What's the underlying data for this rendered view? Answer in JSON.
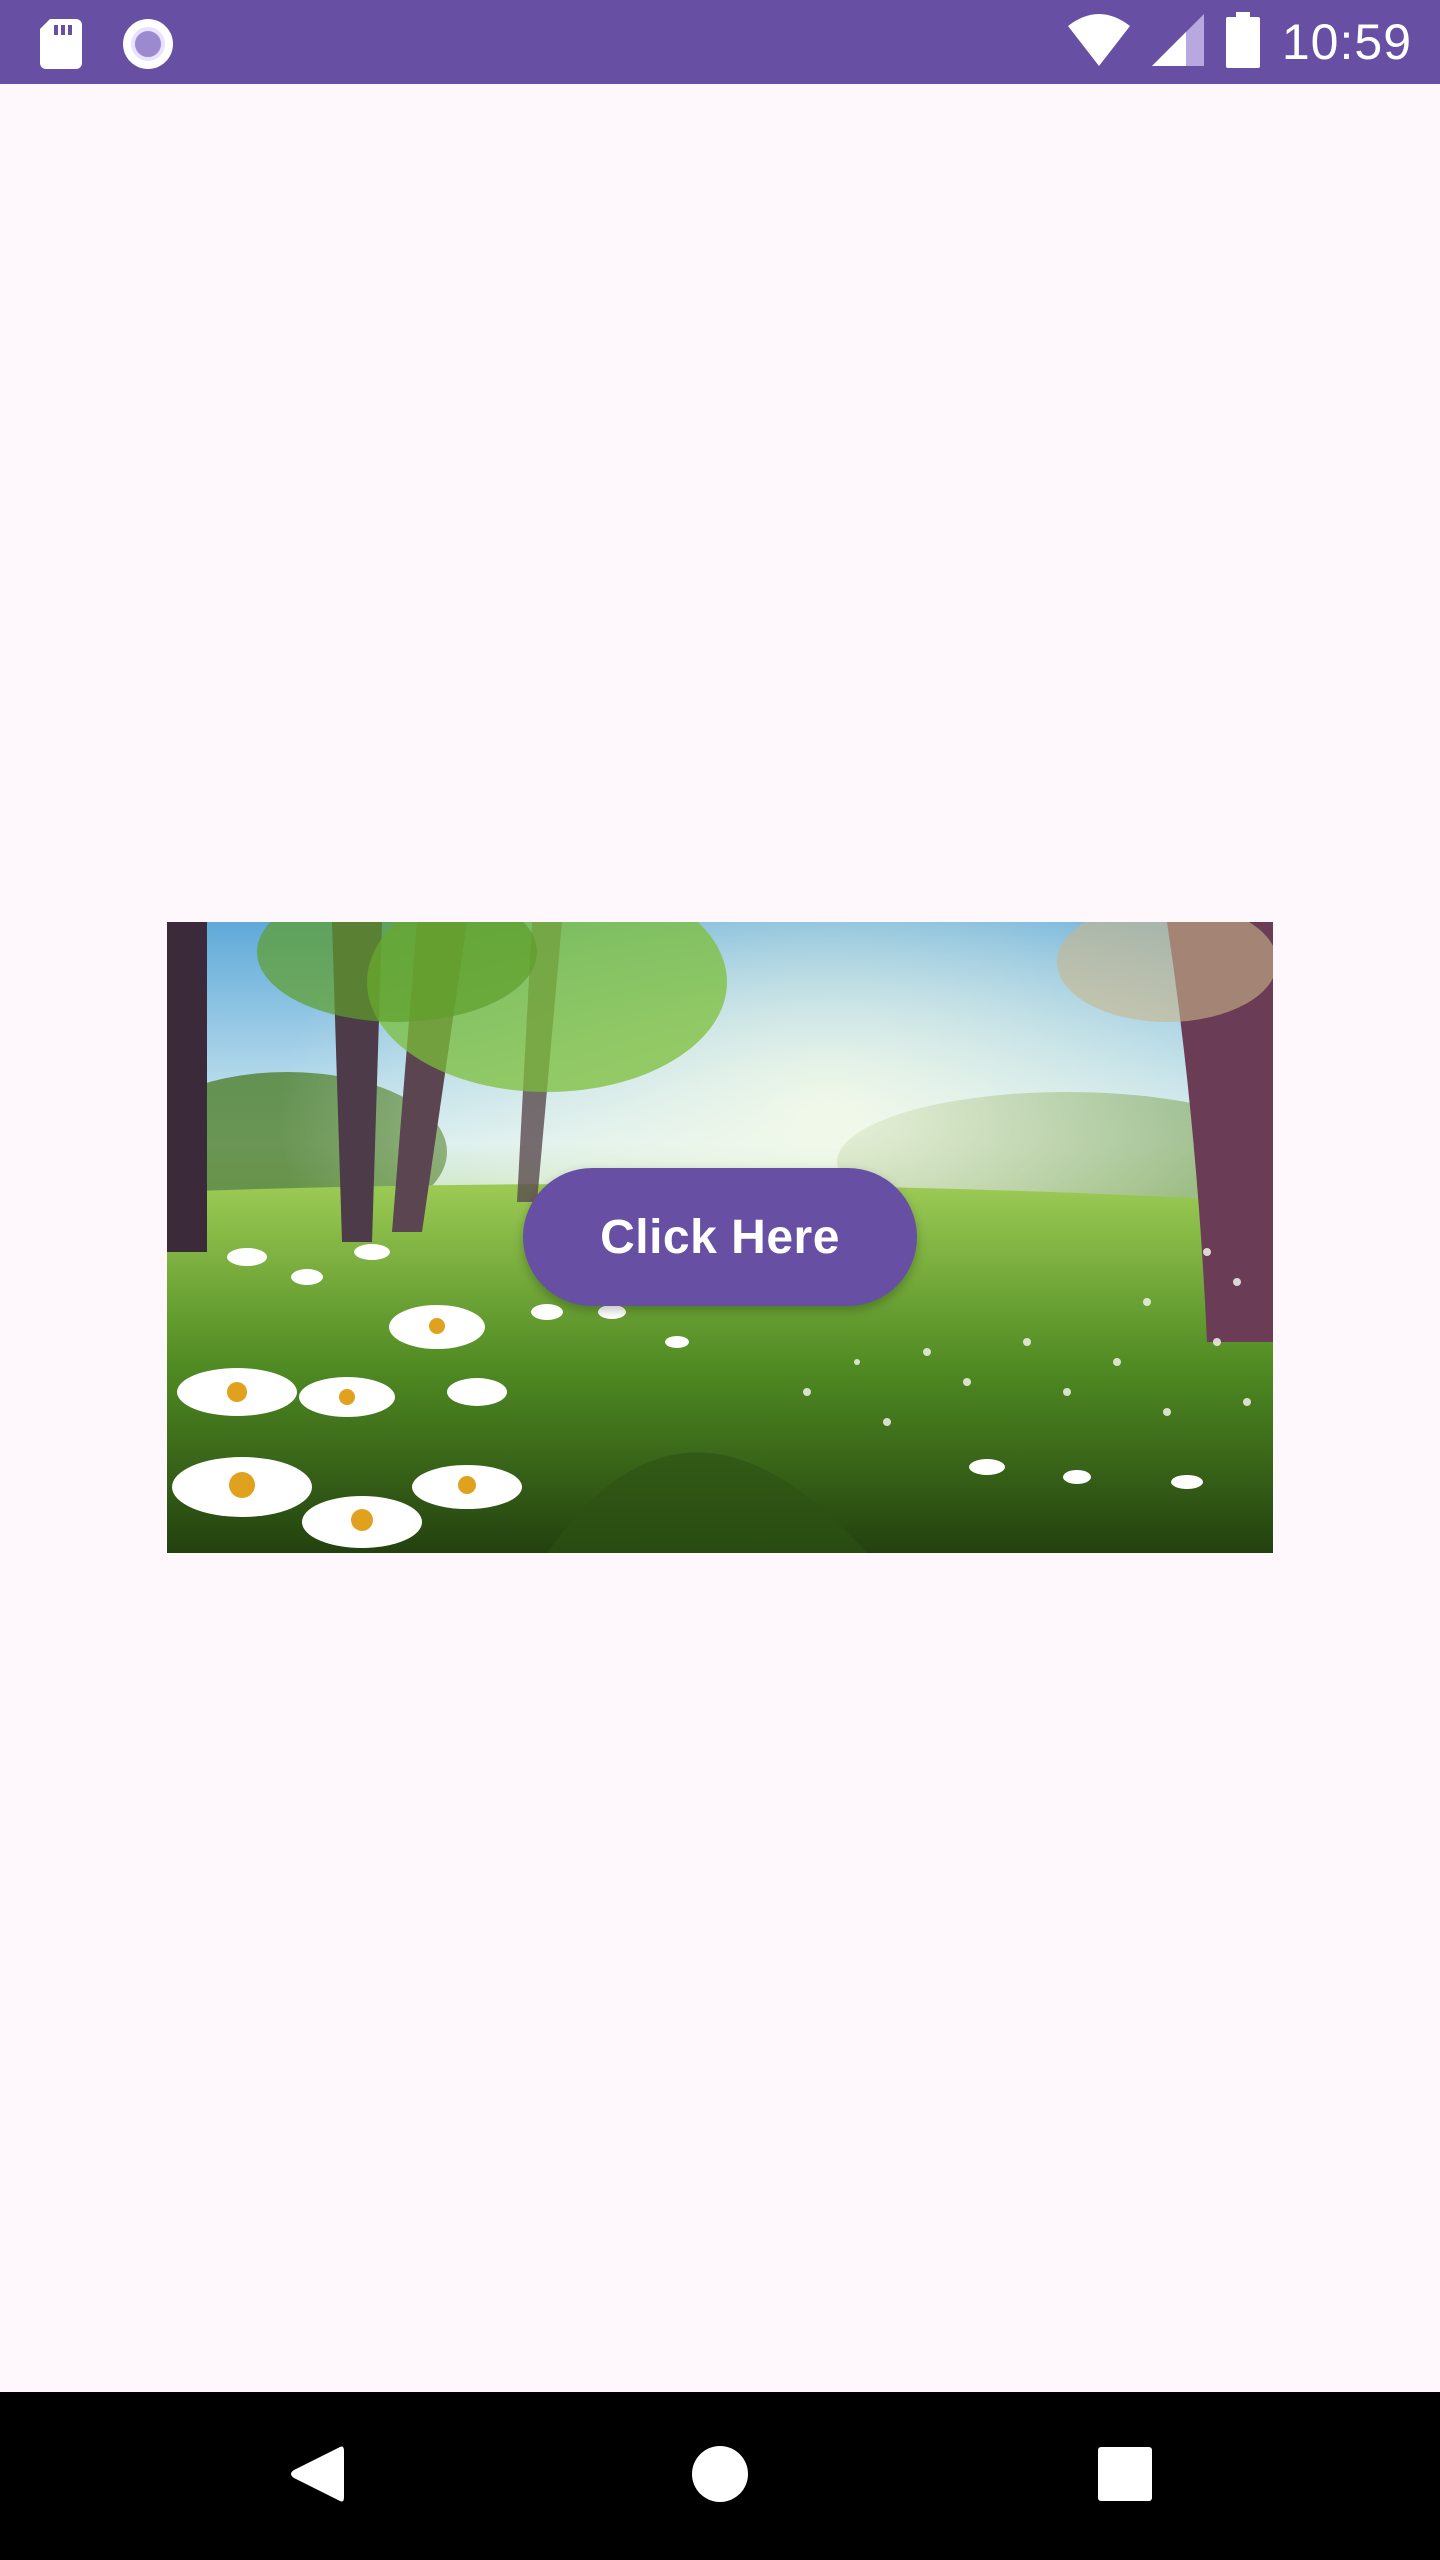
{
  "status_bar": {
    "time": "10:59",
    "icons": [
      "sd-card-icon",
      "circle-record-icon",
      "wifi-icon",
      "cell-signal-icon",
      "battery-icon"
    ],
    "background": "#6750a4"
  },
  "hero": {
    "image": "meadow-daisies-image",
    "button_label": "Click Here",
    "button_color": "#6750a4"
  },
  "nav_bar": {
    "icons": [
      "back-icon",
      "home-icon",
      "recents-icon"
    ],
    "background": "#000000"
  }
}
